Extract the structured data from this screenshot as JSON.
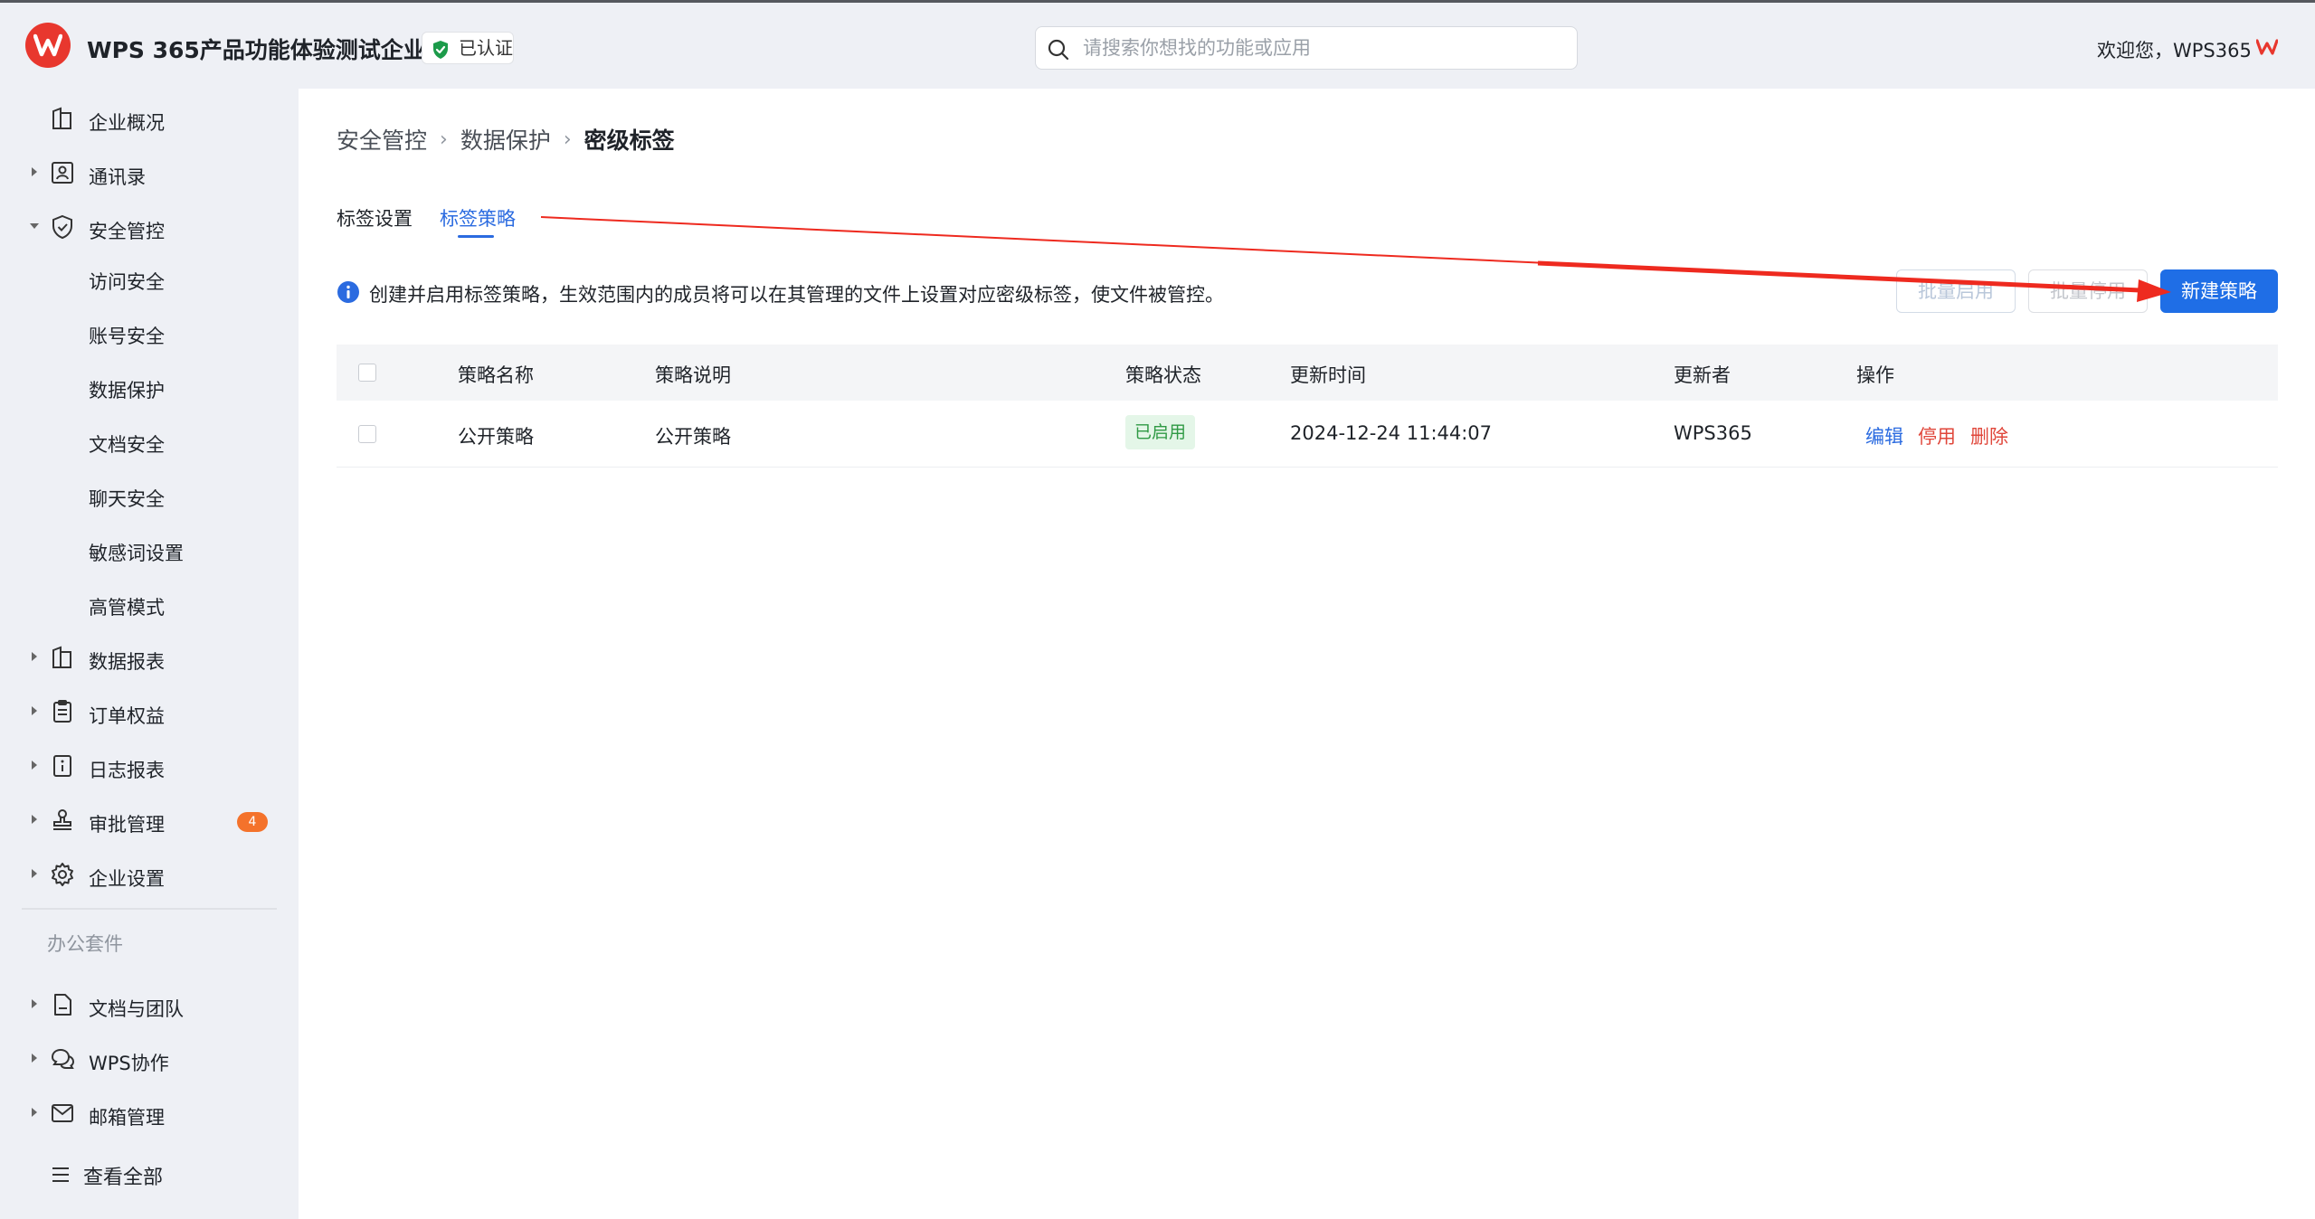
{
  "header": {
    "org_name": "WPS 365产品功能体验测试企业",
    "cert_label": "已认证",
    "search_placeholder": "请搜索你想找的功能或应用",
    "welcome": "欢迎您，WPS365"
  },
  "sidebar": {
    "items": [
      {
        "label": "企业概况"
      },
      {
        "label": "通讯录"
      },
      {
        "label": "安全管控"
      },
      {
        "label": "访问安全"
      },
      {
        "label": "账号安全"
      },
      {
        "label": "数据保护"
      },
      {
        "label": "文档安全"
      },
      {
        "label": "聊天安全"
      },
      {
        "label": "敏感词设置"
      },
      {
        "label": "高管模式"
      },
      {
        "label": "数据报表"
      },
      {
        "label": "订单权益"
      },
      {
        "label": "日志报表"
      },
      {
        "label": "审批管理",
        "badge": "4"
      },
      {
        "label": "企业设置"
      }
    ],
    "section_label": "办公套件",
    "suite_items": [
      {
        "label": "文档与团队"
      },
      {
        "label": "WPS协作"
      },
      {
        "label": "邮箱管理"
      }
    ],
    "view_all": "查看全部"
  },
  "breadcrumb": [
    "安全管控",
    "数据保护",
    "密级标签"
  ],
  "tabs": [
    "标签设置",
    "标签策略"
  ],
  "info_text": "创建并启用标签策略，生效范围内的成员将可以在其管理的文件上设置对应密级标签，使文件被管控。",
  "buttons": {
    "batch_enable": "批量启用",
    "batch_disable": "批量停用",
    "new_policy": "新建策略"
  },
  "table": {
    "columns": [
      "策略名称",
      "策略说明",
      "策略状态",
      "更新时间",
      "更新者",
      "操作"
    ],
    "rows": [
      {
        "name": "公开策略",
        "desc": "公开策略",
        "status": "已启用",
        "updated_at": "2024-12-24 11:44:07",
        "updater": "WPS365",
        "actions": [
          "编辑",
          "停用",
          "删除"
        ]
      }
    ]
  },
  "colors": {
    "primary": "#1f6ee6",
    "brand_red": "#e8372e",
    "status_green": "#2f9a44",
    "danger": "#e0463a",
    "badge_orange": "#f4722b"
  }
}
